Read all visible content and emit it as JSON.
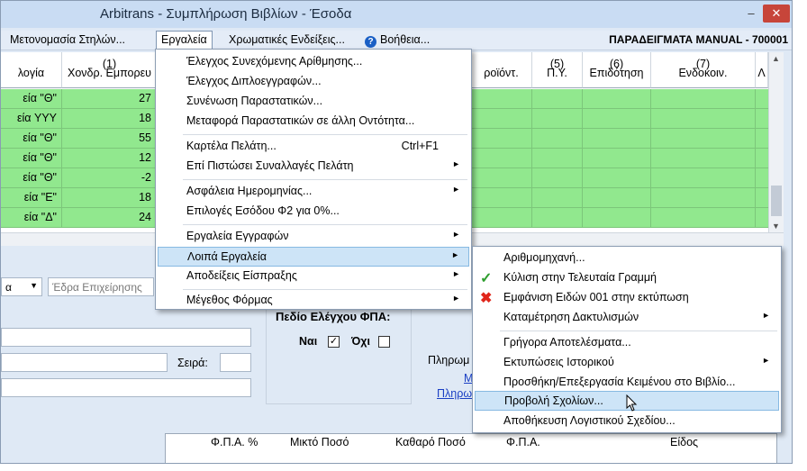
{
  "window": {
    "title": "Arbitrans - Συμπλήρωση Βιβλίων - Έσοδα",
    "minimize": "–",
    "close": "✕"
  },
  "menubar": {
    "items": [
      "Μετονομασία Στηλών...",
      "Εργαλεία",
      "Χρωματικές Ενδείξεις...",
      "Βοήθεια..."
    ],
    "company": "ΠΑΡΑΔΕΙΓΜΑΤΑ MANUAL - 700001"
  },
  "grid": {
    "headers": [
      {
        "num": "",
        "label": "λογία"
      },
      {
        "num": "(1)",
        "label": "Χονδρ. Εμπορευ"
      },
      {
        "num": "",
        "label": "ροϊόντ."
      },
      {
        "num": "(5)",
        "label": "Π.Υ."
      },
      {
        "num": "(6)",
        "label": "Επιδότηση"
      },
      {
        "num": "(7)",
        "label": "Ενδοκοιν."
      },
      {
        "num": "",
        "label": "Λ"
      }
    ],
    "rows": [
      {
        "c0": "εία \"Θ\"",
        "c1": "27"
      },
      {
        "c0": "εία YYY",
        "c1": "18"
      },
      {
        "c0": "εία \"Θ\"",
        "c1": "55"
      },
      {
        "c0": "εία \"Θ\"",
        "c1": "12"
      },
      {
        "c0": "εία \"Θ\"",
        "c1": "-2"
      },
      {
        "c0": "εία \"Ε\"",
        "c1": "18"
      },
      {
        "c0": "εία \"Δ\"",
        "c1": "24"
      }
    ]
  },
  "form": {
    "seat_placeholder": "Έδρα Επιχείρησης",
    "combo_value": "α",
    "series_label": "Σειρά:",
    "vat_title": "Πεδίο Ελέγχου ΦΠΑ:",
    "yes_label": "Ναι",
    "no_label": "Όχι",
    "yes_checked": true,
    "no_checked": false,
    "payment_label": "Πληρωμ",
    "link1": "Μ",
    "link2": "Πληρω"
  },
  "bottom_grid": {
    "headers": [
      "Φ.Π.Α. %",
      "Μικτό Ποσό",
      "Καθαρό Ποσό",
      "Φ.Π.Α.",
      "Είδος"
    ]
  },
  "tools_menu": {
    "items": [
      {
        "label": "Έλεγχος Συνεχόμενης Αρίθμησης...",
        "shortcut": "",
        "submenu": false
      },
      {
        "label": "Έλεγχος Διπλοεγγραφών...",
        "shortcut": "",
        "submenu": false
      },
      {
        "label": "Συνένωση Παραστατικών...",
        "shortcut": "",
        "submenu": false
      },
      {
        "label": "Μεταφορά Παραστατικών σε άλλη Οντότητα...",
        "shortcut": "",
        "submenu": false
      },
      {
        "label": "Καρτέλα Πελάτη...",
        "shortcut": "Ctrl+F1",
        "submenu": false
      },
      {
        "label": "Επί Πιστώσει Συναλλαγές Πελάτη",
        "shortcut": "",
        "submenu": true
      },
      {
        "label": "Ασφάλεια Ημερομηνίας...",
        "shortcut": "",
        "submenu": true
      },
      {
        "label": "Επιλογές Εσόδου Φ2 για 0%...",
        "shortcut": "",
        "submenu": false
      },
      {
        "label": "Εργαλεία Εγγραφών",
        "shortcut": "",
        "submenu": true
      },
      {
        "label": "Λοιπά Εργαλεία",
        "shortcut": "",
        "submenu": true
      },
      {
        "label": "Αποδείξεις Είσπραξης",
        "shortcut": "",
        "submenu": true
      },
      {
        "label": "Μέγεθος Φόρμας",
        "shortcut": "",
        "submenu": true
      }
    ]
  },
  "other_tools_menu": {
    "items": [
      {
        "label": "Αριθμομηχανή...",
        "icon": "",
        "submenu": false
      },
      {
        "label": "Κύλιση στην Τελευταία Γραμμή",
        "icon": "check-icon",
        "submenu": false
      },
      {
        "label": "Εμφάνιση Ειδών 001 στην εκτύπωση",
        "icon": "x-icon",
        "submenu": false
      },
      {
        "label": "Καταμέτρηση Δακτυλισμών",
        "icon": "",
        "submenu": true
      },
      {
        "label": "Γρήγορα Αποτελέσματα...",
        "icon": "",
        "submenu": false
      },
      {
        "label": "Εκτυπώσεις Ιστορικού",
        "icon": "",
        "submenu": true
      },
      {
        "label": "Προσθήκη/Επεξεργασία Κειμένου στο Βιβλίο...",
        "icon": "",
        "submenu": false
      },
      {
        "label": "Προβολή Σχολίων...",
        "icon": "",
        "submenu": false
      },
      {
        "label": "Αποθήκευση Λογιστικού Σχεδίου...",
        "icon": "",
        "submenu": false
      }
    ]
  },
  "colors": {
    "row_green": "#91e88e",
    "highlight": "#cde4f7",
    "check_green": "#2e9e2e",
    "x_red": "#e0261b"
  }
}
